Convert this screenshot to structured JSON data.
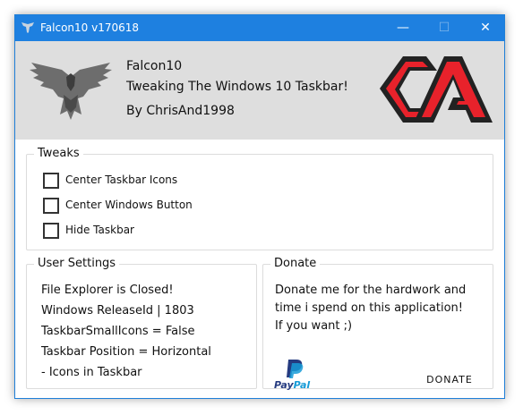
{
  "window": {
    "title": "Falcon10 v170618"
  },
  "titlebar": {
    "minimize_glyph": "—",
    "maximize_glyph": "☐",
    "close_glyph": "✕"
  },
  "header": {
    "app_name": "Falcon10",
    "tagline": "Tweaking The Windows 10 Taskbar!",
    "author": "By ChrisAnd1998",
    "icon": "eagle-icon",
    "logo_text": "CA",
    "colors": {
      "logo_red": "#e8222b",
      "logo_dark": "#222222",
      "accent": "#1e80e0"
    }
  },
  "tweaks": {
    "title": "Tweaks",
    "options": [
      {
        "label": "Center Taskbar Icons",
        "checked": false
      },
      {
        "label": "Center Windows Button",
        "checked": false
      },
      {
        "label": "Hide Taskbar",
        "checked": false
      }
    ]
  },
  "user_settings": {
    "title": "User Settings",
    "lines": [
      "File Explorer is Closed!",
      "Windows ReleaseId | 1803",
      "TaskbarSmallIcons = False",
      "Taskbar Position = Horizontal",
      "- Icons in Taskbar"
    ]
  },
  "donate": {
    "title": "Donate",
    "lines": [
      "Donate me for the hardwork and",
      "time i spend on this application!",
      "If you want ;)"
    ],
    "paypal_pay": "Pay",
    "paypal_pal": "Pal",
    "button_label": "DONATE",
    "colors": {
      "paypal_dark": "#253b80",
      "paypal_light": "#179bd7"
    }
  }
}
